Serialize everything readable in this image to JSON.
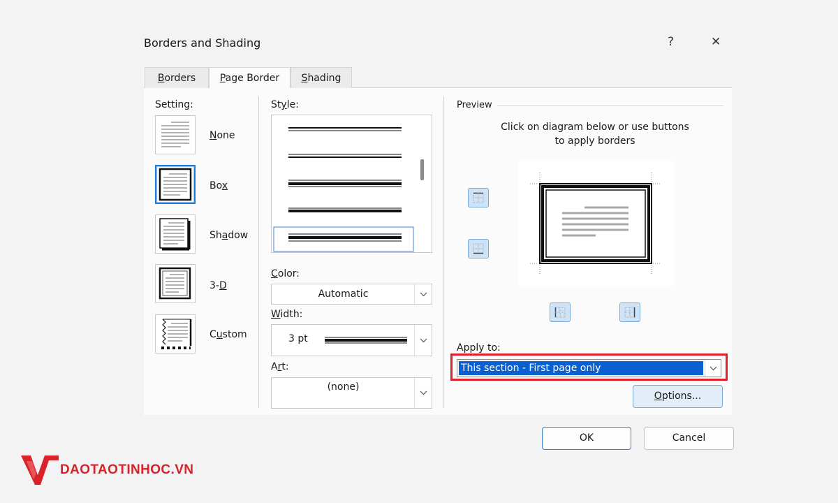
{
  "dialog": {
    "title": "Borders and Shading",
    "help_label": "?",
    "close_label": "✕"
  },
  "tabs": [
    {
      "label": "Borders",
      "accel": "B",
      "active": false
    },
    {
      "label": "Page Border",
      "accel": "P",
      "active": true
    },
    {
      "label": "Shading",
      "accel": "S",
      "active": false
    }
  ],
  "setting": {
    "label": "Setting:",
    "items": [
      {
        "label": "None",
        "accel": "N",
        "selected": false
      },
      {
        "label": "Box",
        "accel": "x",
        "selected": true
      },
      {
        "label": "Shadow",
        "accel": "a",
        "selected": false
      },
      {
        "label": "3-D",
        "accel": "D",
        "selected": false
      },
      {
        "label": "Custom",
        "accel": "u",
        "selected": false
      }
    ]
  },
  "style": {
    "label": "Style:",
    "accel": "y"
  },
  "color": {
    "label": "Color:",
    "accel": "C",
    "value": "Automatic"
  },
  "width": {
    "label": "Width:",
    "accel": "W",
    "value": "3 pt"
  },
  "art": {
    "label": "Art:",
    "accel": "r",
    "value": "(none)"
  },
  "preview": {
    "label": "Preview",
    "hint_line1": "Click on diagram below or use buttons",
    "hint_line2": "to apply borders"
  },
  "apply_to": {
    "label": "Apply to:",
    "accel": "L",
    "value": "This section - First page only"
  },
  "buttons": {
    "options": "Options...",
    "options_accel": "O",
    "ok": "OK",
    "cancel": "Cancel"
  },
  "watermark": {
    "text": "DAOTAOTINHOC.VN"
  },
  "colors": {
    "accent": "#1e78d6",
    "highlight": "#e0202a",
    "selection": "#0a5fd1",
    "brand": "#d8232a"
  }
}
